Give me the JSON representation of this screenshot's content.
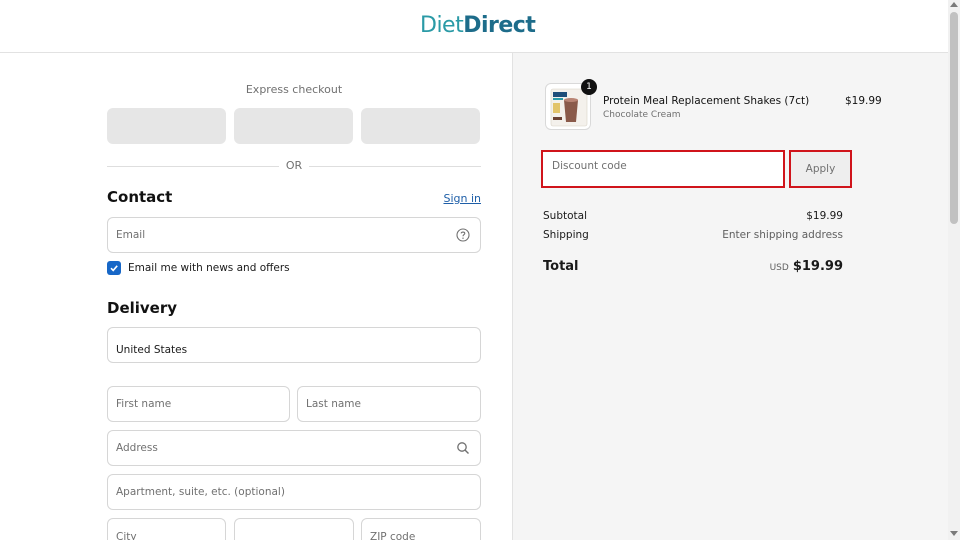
{
  "header": {
    "logo_part1": "Diet",
    "logo_part2": "Direct"
  },
  "express": {
    "label": "Express checkout",
    "or_text": "OR"
  },
  "contact": {
    "title": "Contact",
    "sign_in": "Sign in",
    "email_placeholder": "Email",
    "news_checkbox_label": "Email me with news and offers",
    "news_checked": true
  },
  "delivery": {
    "title": "Delivery",
    "country": "United States",
    "first_name_placeholder": "First name",
    "last_name_placeholder": "Last name",
    "address_placeholder": "Address",
    "apartment_placeholder": "Apartment, suite, etc. (optional)",
    "city_placeholder": "City",
    "zip_placeholder": "ZIP code"
  },
  "cart": {
    "item": {
      "quantity": "1",
      "name": "Protein Meal Replacement Shakes (7ct)",
      "variant": "Chocolate Cream",
      "price": "$19.99"
    },
    "discount_placeholder": "Discount code",
    "apply_label": "Apply",
    "subtotal_label": "Subtotal",
    "subtotal_value": "$19.99",
    "shipping_label": "Shipping",
    "shipping_value": "Enter shipping address",
    "total_label": "Total",
    "currency": "USD",
    "total_value": "$19.99"
  },
  "colors": {
    "logo_light": "#2a9aa6",
    "logo_dark": "#1d6c8a",
    "link": "#1f5fa8",
    "checkbox": "#1767c7",
    "highlight_border": "#d0141b"
  }
}
